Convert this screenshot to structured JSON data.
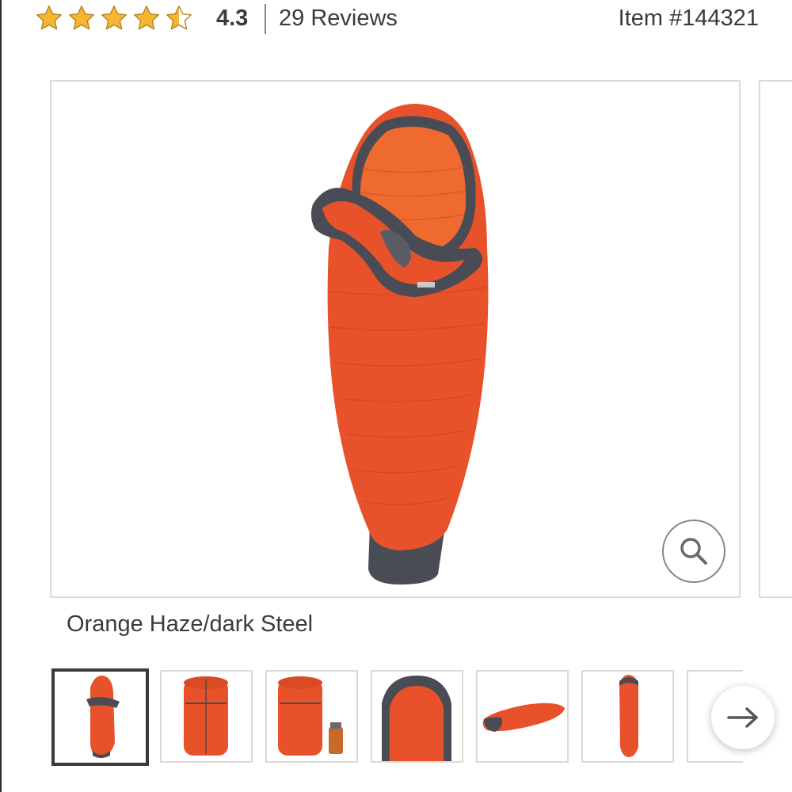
{
  "rating": {
    "value": "4.3",
    "stars_filled": 4.3,
    "stars_total": 5,
    "reviews_text": "29 Reviews",
    "star_color": "#f5b731"
  },
  "item_number": "Item #144321",
  "main_image": {
    "alt": "Orange sleeping bag with dark steel trim",
    "zoom_icon": "search-icon"
  },
  "color_name": "Orange Haze/dark Steel",
  "thumbnails": [
    {
      "name": "sleeping-bag-front",
      "selected": true
    },
    {
      "name": "stuff-sack"
    },
    {
      "name": "stuff-sack-with-bottle"
    },
    {
      "name": "hood-closeup"
    },
    {
      "name": "bag-lying-flat"
    },
    {
      "name": "bag-full-length"
    },
    {
      "name": "partial-thumbnail"
    }
  ],
  "next_icon": "arrow-right-icon",
  "colors": {
    "orange": "#e8522a",
    "dark_steel": "#4a4c55",
    "border": "#dcdad5",
    "text": "#3c3b39"
  }
}
